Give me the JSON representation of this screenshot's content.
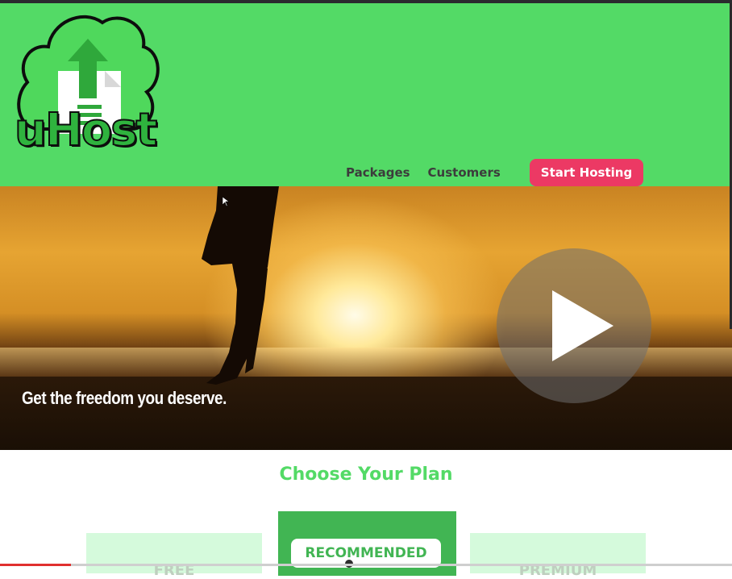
{
  "brand": {
    "logo_text": "uHost",
    "color": "#53da66"
  },
  "nav": {
    "links": [
      "Packages",
      "Customers"
    ],
    "cta": "Start Hosting",
    "cta_color": "#ec3964"
  },
  "hero": {
    "tagline": "Get the freedom you deserve.",
    "play_icon": "play-icon"
  },
  "plans": {
    "title": "Choose Your Plan",
    "cards": [
      {
        "name": "FREE"
      },
      {
        "badge": "RECOMMENDED"
      },
      {
        "name": "PREMIUM"
      }
    ]
  },
  "video": {
    "progress": 0.097
  }
}
